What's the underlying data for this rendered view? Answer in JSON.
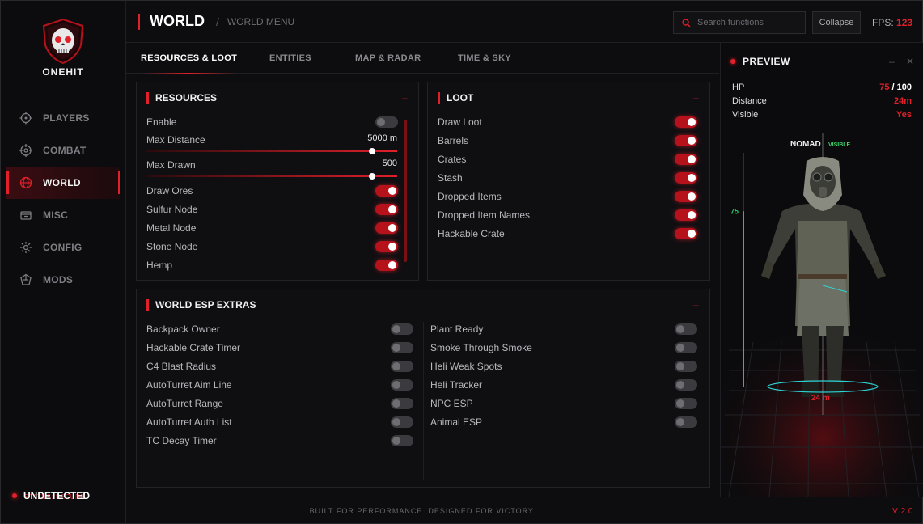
{
  "logo": {
    "text": "ONEHIT"
  },
  "sidebar": {
    "items": [
      {
        "label": "PLAYERS",
        "icon": "crosshair-icon"
      },
      {
        "label": "COMBAT",
        "icon": "target-icon"
      },
      {
        "label": "WORLD",
        "icon": "globe-icon",
        "active": true
      },
      {
        "label": "MISC",
        "icon": "box-icon"
      },
      {
        "label": "CONFIG",
        "icon": "gear-icon"
      },
      {
        "label": "MODS",
        "icon": "puzzle-icon"
      }
    ]
  },
  "status": {
    "title": "UNDETECTED",
    "sub": "STATUS: SECURE"
  },
  "header": {
    "title": "WORLD",
    "separator": "/",
    "crumb": "WORLD MENU",
    "search_placeholder": "Search functions",
    "collapse_label": "Collapse",
    "fps_label": "FPS:",
    "fps_value": "123"
  },
  "tabs": [
    "RESOURCES & LOOT",
    "ENTITIES",
    "MAP & RADAR",
    "TIME & SKY"
  ],
  "resources": {
    "title": "RESOURCES",
    "minus": "–",
    "enable_label": "Enable",
    "enable_on": false,
    "max_distance": {
      "label": "Max Distance",
      "value": "5000 m",
      "fraction": 0.9
    },
    "max_drawn": {
      "label": "Max Drawn",
      "value": "500",
      "fraction": 0.9
    },
    "toggles": [
      {
        "label": "Draw Ores",
        "on": true
      },
      {
        "label": "Sulfur Node",
        "on": true
      },
      {
        "label": "Metal Node",
        "on": true
      },
      {
        "label": "Stone Node",
        "on": true
      },
      {
        "label": "Hemp",
        "on": true
      }
    ]
  },
  "loot": {
    "title": "LOOT",
    "minus": "–",
    "toggles": [
      {
        "label": "Draw Loot",
        "on": true
      },
      {
        "label": "Barrels",
        "on": true
      },
      {
        "label": "Crates",
        "on": true
      },
      {
        "label": "Stash",
        "on": true
      },
      {
        "label": "Dropped Items",
        "on": true
      },
      {
        "label": "Dropped Item Names",
        "on": true
      },
      {
        "label": "Hackable Crate",
        "on": true
      }
    ]
  },
  "extras": {
    "title": "WORLD ESP EXTRAS",
    "minus": "–",
    "left": [
      {
        "label": "Backpack Owner",
        "on": false
      },
      {
        "label": "Hackable Crate Timer",
        "on": false
      },
      {
        "label": "C4 Blast Radius",
        "on": false
      },
      {
        "label": "AutoTurret Aim Line",
        "on": false
      },
      {
        "label": "AutoTurret Range",
        "on": false
      },
      {
        "label": "AutoTurret Auth List",
        "on": false
      },
      {
        "label": "TC Decay Timer",
        "on": false
      }
    ],
    "right": [
      {
        "label": "Plant Ready",
        "on": false
      },
      {
        "label": "Smoke Through Smoke",
        "on": false
      },
      {
        "label": "Heli Weak Spots",
        "on": false
      },
      {
        "label": "Heli Tracker",
        "on": false
      },
      {
        "label": "NPC ESP",
        "on": false
      },
      {
        "label": "Animal ESP",
        "on": false
      }
    ]
  },
  "preview": {
    "title": "PREVIEW",
    "minimize": "–",
    "close": "✕",
    "hp_label": "HP",
    "hp_value": "75",
    "hp_sep": " / ",
    "hp_max": "100",
    "distance_label": "Distance",
    "distance_value": "24m",
    "visible_label": "Visible",
    "visible_value": "Yes",
    "name": "NOMAD",
    "visible_tag": "VISIBLE",
    "hp_bar_label": "75",
    "hp_fraction": 0.75,
    "distance_tag": "24 m"
  },
  "footer": {
    "tagline": "BUILT FOR PERFORMANCE. DESIGNED FOR VICTORY.",
    "version": "V 2.0"
  },
  "colors": {
    "accent": "#e0202a",
    "visible": "#3fd36a",
    "hp_bar": "#22c55e"
  }
}
